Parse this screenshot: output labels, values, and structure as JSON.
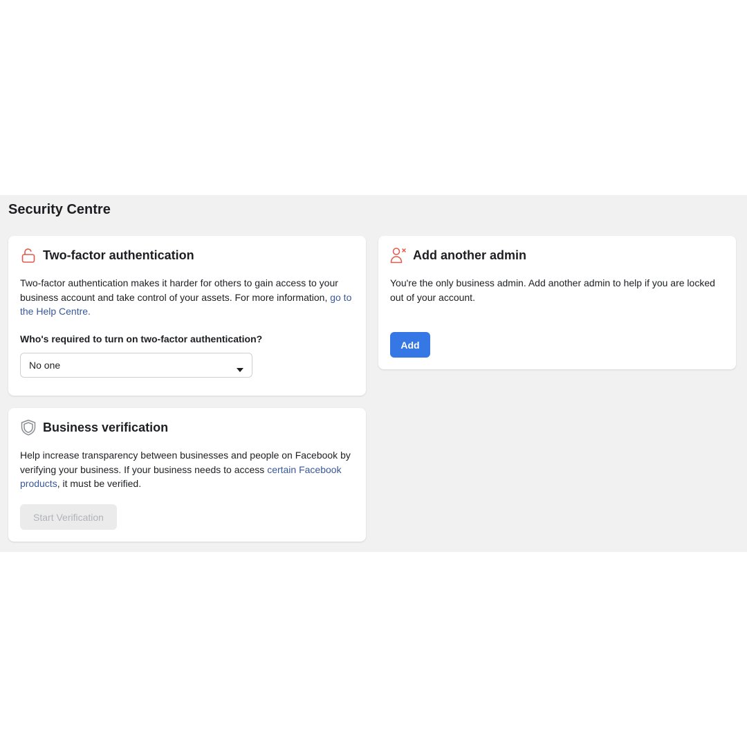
{
  "page": {
    "title": "Security Centre",
    "background_color": "#f1f1f1"
  },
  "two_factor": {
    "icon": "unlocked-padlock-icon",
    "title": "Two-factor authentication",
    "description": "Two-factor authentication makes it harder for others to gain access to your business account and take control of your assets. For more information, ",
    "link_text": "go to the Help Centre.",
    "question": "Who's required to turn on two-factor authentication?",
    "select_value": "No one",
    "icon_color": "#e4584a"
  },
  "business_verification": {
    "icon": "shield-icon",
    "title": "Business verification",
    "description_before": "Help increase transparency between businesses and people on Facebook by verifying your business. If your business needs to access ",
    "link_text": "certain Facebook products",
    "description_after": ", it must be verified.",
    "button_label": "Start Verification",
    "button_state": "disabled"
  },
  "add_admin": {
    "icon": "remove-person-icon",
    "title": "Add another admin",
    "description": "You're the only business admin. Add another admin to help if you are locked out of your account.",
    "button_label": "Add",
    "button_color": "#3578e5"
  },
  "link_color": "#385898"
}
